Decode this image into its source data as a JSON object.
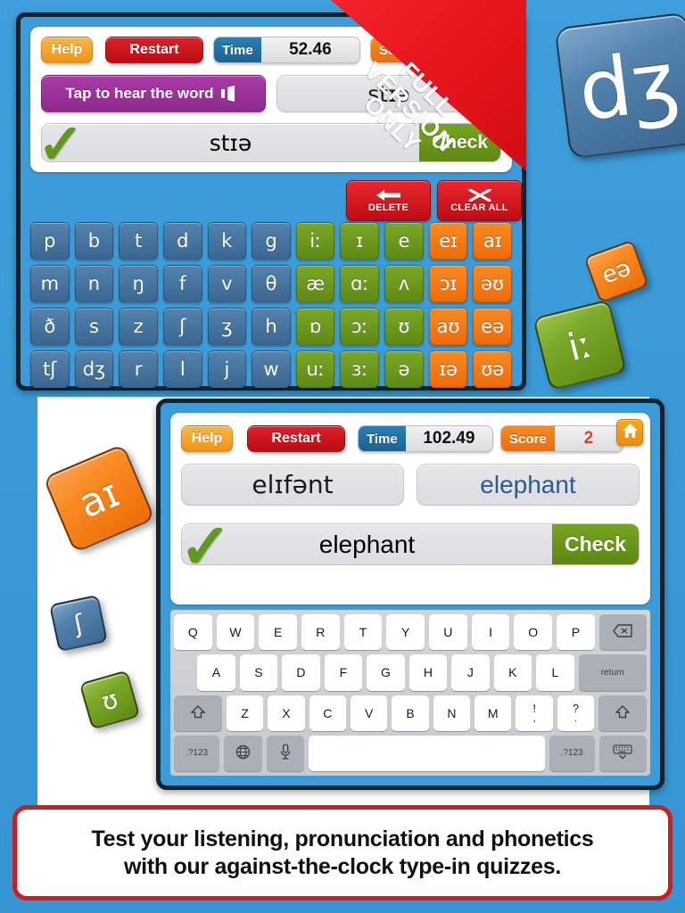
{
  "background": {
    "blue": "#3b9cd9",
    "panel": "#ffffff"
  },
  "ribbon": {
    "line1": "FULL",
    "line2": "VERSION",
    "line3": "ONLY",
    "color": "#e3131b"
  },
  "screen_top": {
    "toolbar": {
      "help_label": "Help",
      "restart_label": "Restart",
      "time_label": "Time",
      "time_value": "52.46",
      "score_label": "Score",
      "score_value": ""
    },
    "listen_button_label": "Tap to hear the word",
    "listen_icon": "speaker-icon",
    "prompt_field_value": "stɪə",
    "answer_value": "stɪə",
    "check_label": "Check",
    "tick_icon": "green-check-icon",
    "actions": [
      {
        "label": "DELETE",
        "icon": "left-arrow-icon"
      },
      {
        "label": "CLEAR ALL",
        "icon": "cross-icon"
      }
    ],
    "ipa_keyboard": {
      "rows": [
        [
          {
            "ch": "p",
            "color": "blue"
          },
          {
            "ch": "b",
            "color": "blue"
          },
          {
            "ch": "t",
            "color": "blue"
          },
          {
            "ch": "d",
            "color": "blue"
          },
          {
            "ch": "k",
            "color": "blue"
          },
          {
            "ch": "g",
            "color": "blue"
          },
          {
            "ch": "iː",
            "color": "green"
          },
          {
            "ch": "ɪ",
            "color": "green"
          },
          {
            "ch": "e",
            "color": "green"
          },
          {
            "ch": "eɪ",
            "color": "orange"
          },
          {
            "ch": "aɪ",
            "color": "orange"
          }
        ],
        [
          {
            "ch": "m",
            "color": "blue"
          },
          {
            "ch": "n",
            "color": "blue"
          },
          {
            "ch": "ŋ",
            "color": "blue"
          },
          {
            "ch": "f",
            "color": "blue"
          },
          {
            "ch": "v",
            "color": "blue"
          },
          {
            "ch": "θ",
            "color": "blue"
          },
          {
            "ch": "æ",
            "color": "green"
          },
          {
            "ch": "ɑː",
            "color": "green"
          },
          {
            "ch": "ʌ",
            "color": "green"
          },
          {
            "ch": "ɔɪ",
            "color": "orange"
          },
          {
            "ch": "əʊ",
            "color": "orange"
          }
        ],
        [
          {
            "ch": "ð",
            "color": "blue"
          },
          {
            "ch": "s",
            "color": "blue"
          },
          {
            "ch": "z",
            "color": "blue"
          },
          {
            "ch": "ʃ",
            "color": "blue"
          },
          {
            "ch": "ʒ",
            "color": "blue"
          },
          {
            "ch": "h",
            "color": "blue"
          },
          {
            "ch": "ɒ",
            "color": "green"
          },
          {
            "ch": "ɔː",
            "color": "green"
          },
          {
            "ch": "ʊ",
            "color": "green"
          },
          {
            "ch": "aʊ",
            "color": "orange"
          },
          {
            "ch": "eə",
            "color": "orange"
          }
        ],
        [
          {
            "ch": "tʃ",
            "color": "blue"
          },
          {
            "ch": "dʒ",
            "color": "blue"
          },
          {
            "ch": "r",
            "color": "blue"
          },
          {
            "ch": "l",
            "color": "blue"
          },
          {
            "ch": "j",
            "color": "blue"
          },
          {
            "ch": "w",
            "color": "blue"
          },
          {
            "ch": "uː",
            "color": "green"
          },
          {
            "ch": "ɜː",
            "color": "green"
          },
          {
            "ch": "ə",
            "color": "green"
          },
          {
            "ch": "ɪə",
            "color": "orange"
          },
          {
            "ch": "ʊə",
            "color": "orange"
          }
        ]
      ]
    }
  },
  "screen_bottom": {
    "toolbar": {
      "help_label": "Help",
      "restart_label": "Restart",
      "time_label": "Time",
      "time_value": "102.49",
      "score_label": "Score",
      "score_value": "2",
      "home_icon": "home-icon"
    },
    "phonetic_field_value": "elɪfənt",
    "word_field_value": "elephant",
    "answer_value": "elephant",
    "check_label": "Check",
    "tick_icon": "green-check-icon",
    "qwerty": {
      "row1": [
        "Q",
        "W",
        "E",
        "R",
        "T",
        "Y",
        "U",
        "I",
        "O",
        "P"
      ],
      "row1_extra": {
        "name": "backspace-key",
        "icon": "backspace-icon"
      },
      "row2": [
        "A",
        "S",
        "D",
        "F",
        "G",
        "H",
        "J",
        "K",
        "L"
      ],
      "row2_extra": {
        "name": "return-key",
        "label": "return"
      },
      "row3": [
        "Z",
        "X",
        "C",
        "V",
        "B",
        "N",
        "M"
      ],
      "row3_dual": [
        {
          "top": "!",
          "bottom": ","
        },
        {
          "top": "?",
          "bottom": "."
        }
      ],
      "shift_label": "shift-icon",
      "row4": {
        "numbers_left": ".?123",
        "globe": "globe-icon",
        "mic": "microphone-icon",
        "space": "",
        "numbers_right": ".?123",
        "hide": "hide-keyboard-icon"
      }
    }
  },
  "floating_tiles": [
    {
      "ch": "dʒ",
      "color": "blue",
      "name": "floating-tile-dz"
    },
    {
      "ch": "eə",
      "color": "orange",
      "name": "floating-tile-ea"
    },
    {
      "ch": "iː",
      "color": "green",
      "name": "floating-tile-ii"
    },
    {
      "ch": "aɪ",
      "color": "orange",
      "name": "floating-tile-ai"
    },
    {
      "ch": "ʃ",
      "color": "blue",
      "name": "floating-tile-sh"
    },
    {
      "ch": "ʊ",
      "color": "green",
      "name": "floating-tile-uu"
    }
  ],
  "caption": {
    "line1": "Test your listening, pronunciation and phonetics",
    "line2": "with our against-the-clock type-in quizzes."
  }
}
